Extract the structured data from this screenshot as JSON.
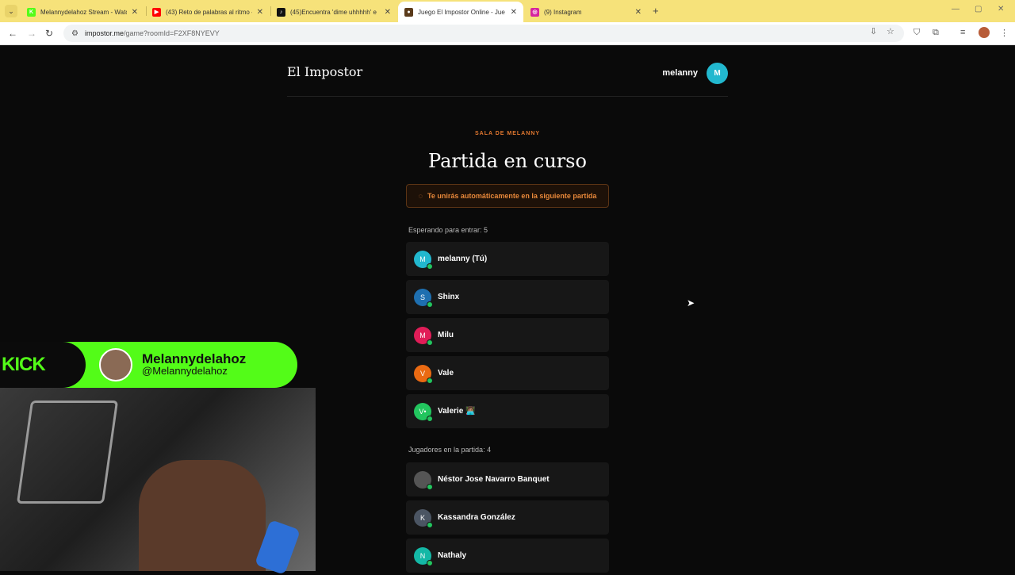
{
  "browser": {
    "tabs": [
      {
        "title": "Melannydelahoz Stream - Watc",
        "icon": "kick-icon",
        "icon_color": "#53fc18",
        "icon_text": "K",
        "active": false
      },
      {
        "title": "(43) Reto de palabras al ritmo -",
        "icon": "youtube-icon",
        "icon_color": "#ff0000",
        "icon_text": "▶",
        "active": false
      },
      {
        "title": "(45)Encuentra 'dime uhhhhh' e",
        "icon": "tiktok-icon",
        "icon_color": "#111111",
        "icon_text": "♪",
        "active": false
      },
      {
        "title": "Juego El Impostor Online - Jue",
        "icon": "impostor-icon",
        "icon_color": "#5a3a1a",
        "icon_text": "●",
        "active": true
      },
      {
        "title": "(9) Instagram",
        "icon": "instagram-icon",
        "icon_color": "#d6249f",
        "icon_text": "◎",
        "active": false
      }
    ],
    "url_host": "impostor.me",
    "url_path": "/game?roomId=F2XF8NYEVY"
  },
  "header": {
    "logo": "El Impostor",
    "username": "melanny",
    "avatar_letter": "M"
  },
  "game": {
    "room_label": "SALA DE MELANNY",
    "title": "Partida en curso",
    "notice": "Te unirás automáticamente en la siguiente partida",
    "waiting_label": "Esperando para entrar: 5",
    "waiting": [
      {
        "name": "melanny (Tú)",
        "letter": "M",
        "color": "#22b8cf"
      },
      {
        "name": "Shinx",
        "letter": "S",
        "color": "#1e6fb0"
      },
      {
        "name": "Milu",
        "letter": "M",
        "color": "#e11d58"
      },
      {
        "name": "Vale",
        "letter": "V",
        "color": "#ea6a12"
      },
      {
        "name": "Valerie 👩🏽‍💻",
        "letter": "V•",
        "color": "#22c55e"
      }
    ],
    "playing_label": "Jugadores en la partida: 4",
    "playing": [
      {
        "name": "Néstor Jose Navarro Banquet",
        "letter": "",
        "color": "#555555"
      },
      {
        "name": "Kassandra González",
        "letter": "K",
        "color": "#4b5563"
      },
      {
        "name": "Nathaly",
        "letter": "N",
        "color": "#14b8a6"
      }
    ]
  },
  "overlay": {
    "brand": "KICK",
    "streamer_name": "Melannydelahoz",
    "streamer_handle": "@Melannydelahoz"
  }
}
